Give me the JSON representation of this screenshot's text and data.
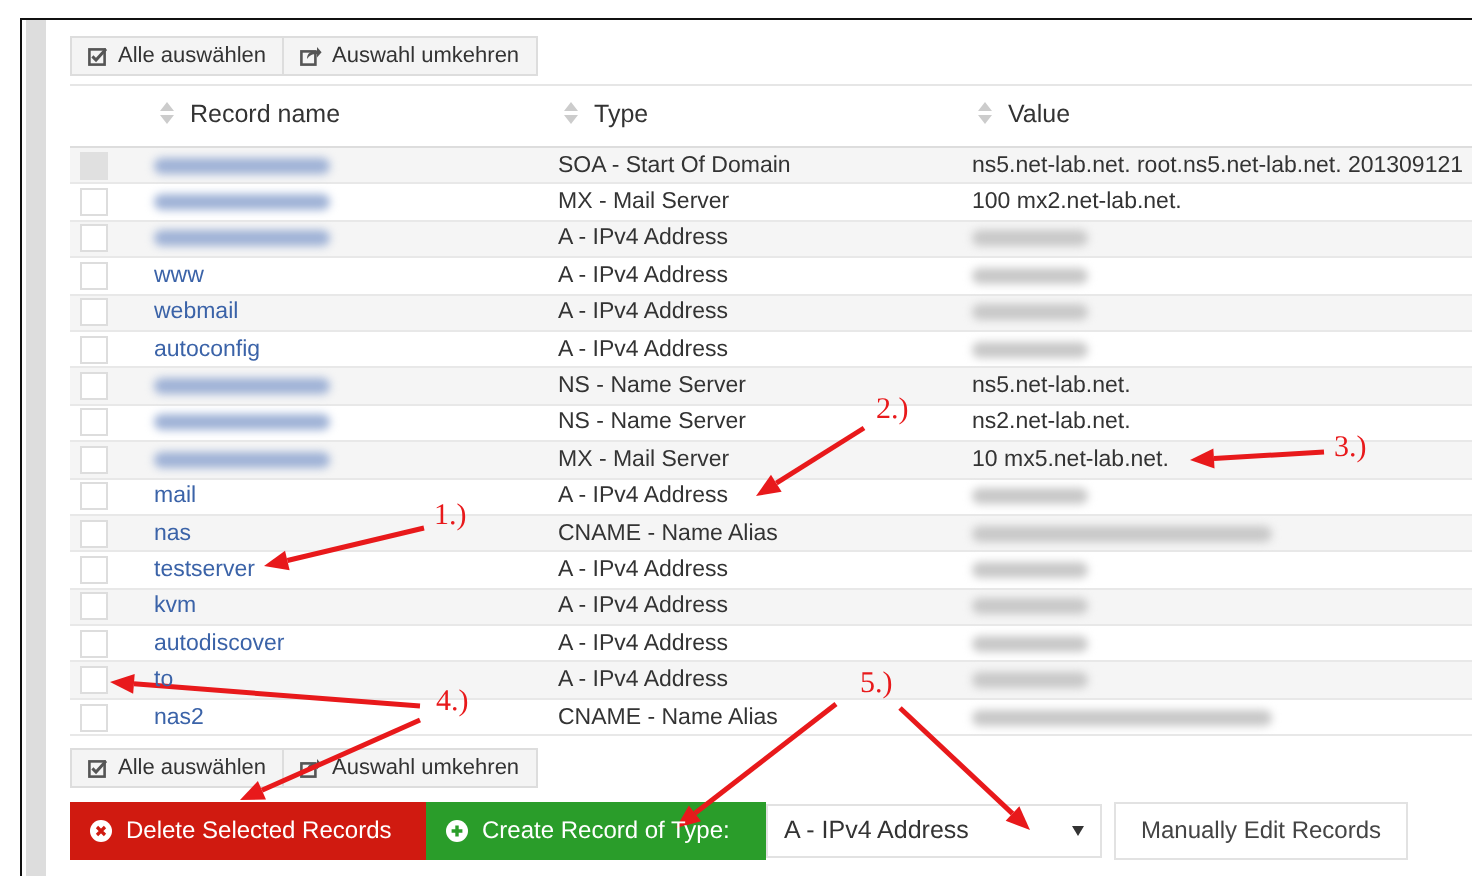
{
  "toolbar_top": [
    {
      "kind": "select_all",
      "label": "Alle auswählen"
    },
    {
      "kind": "invert",
      "label": "Auswahl umkehren"
    }
  ],
  "table": {
    "columns": [
      "Record name",
      "Type",
      "Value"
    ],
    "rows": [
      {
        "name_blurred": true,
        "type": "SOA - Start Of Domain",
        "value": "ns5.net-lab.net. root.ns5.net-lab.net. 201309121",
        "checked": false,
        "disabled": true
      },
      {
        "name_blurred": true,
        "type": "MX - Mail Server",
        "value": "100 mx2.net-lab.net.",
        "checked": false,
        "disabled": false
      },
      {
        "name_blurred": true,
        "type": "A - IPv4 Address",
        "value_blurred": true,
        "checked": false,
        "disabled": false
      },
      {
        "name": "www",
        "type": "A - IPv4 Address",
        "value_blurred": true,
        "checked": false,
        "disabled": false
      },
      {
        "name": "webmail",
        "type": "A - IPv4 Address",
        "value_blurred": true,
        "checked": false,
        "disabled": false
      },
      {
        "name": "autoconfig",
        "type": "A - IPv4 Address",
        "value_blurred": true,
        "checked": false,
        "disabled": false
      },
      {
        "name_blurred": true,
        "type": "NS - Name Server",
        "value": "ns5.net-lab.net.",
        "checked": false,
        "disabled": false
      },
      {
        "name_blurred": true,
        "type": "NS - Name Server",
        "value": "ns2.net-lab.net.",
        "checked": false,
        "disabled": false
      },
      {
        "name_blurred": true,
        "type": "MX - Mail Server",
        "value": "10 mx5.net-lab.net.",
        "checked": false,
        "disabled": false
      },
      {
        "name": "mail",
        "type": "A - IPv4 Address",
        "value_blurred": true,
        "checked": false,
        "disabled": false
      },
      {
        "name": "nas",
        "type": "CNAME - Name Alias",
        "value_blurred": true,
        "checked": false,
        "disabled": false
      },
      {
        "name": "testserver",
        "type": "A - IPv4 Address",
        "value_blurred": true,
        "checked": false,
        "disabled": false
      },
      {
        "name": "kvm",
        "type": "A - IPv4 Address",
        "value_blurred": true,
        "checked": false,
        "disabled": false
      },
      {
        "name": "autodiscover",
        "type": "A - IPv4 Address",
        "value_blurred": true,
        "checked": false,
        "disabled": false
      },
      {
        "name": "to",
        "type": "A - IPv4 Address",
        "value_blurred": true,
        "checked": false,
        "disabled": false
      },
      {
        "name": "nas2",
        "type": "CNAME - Name Alias",
        "value_blurred": true,
        "checked": false,
        "disabled": false
      }
    ]
  },
  "toolbar_bottom": [
    {
      "kind": "select_all",
      "label": "Alle auswählen"
    },
    {
      "kind": "invert",
      "label": "Auswahl umkehren"
    }
  ],
  "actions": {
    "delete": "Delete Selected Records",
    "create": "Create Record of Type:",
    "record_type": "A - IPv4 Address",
    "manual": "Manually Edit Records"
  },
  "annotations": [
    {
      "label": "1.)"
    },
    {
      "label": "2.)"
    },
    {
      "label": "3.)"
    },
    {
      "label": "4.)"
    },
    {
      "label": "5.)"
    }
  ]
}
